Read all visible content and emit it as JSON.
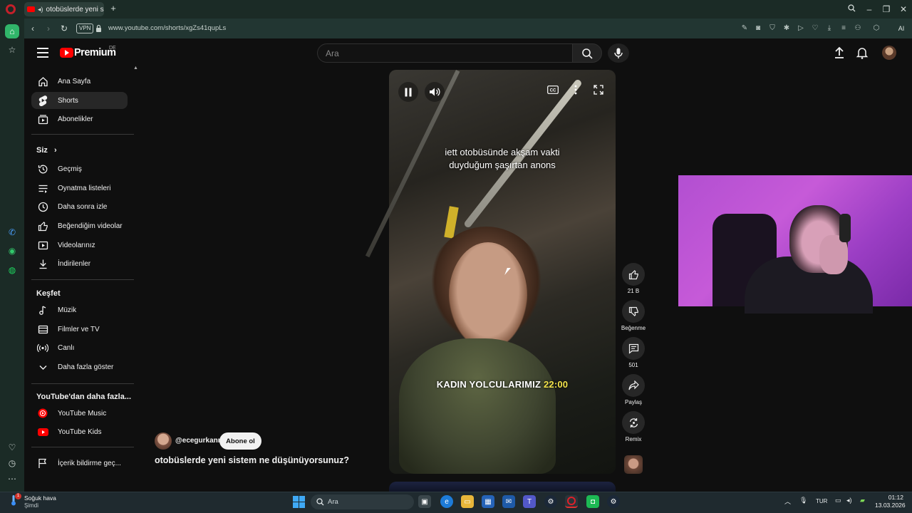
{
  "browser": {
    "tab_title": "otobüslerde yeni siste",
    "url": "www.youtube.com/shorts/xgZs41qupLs",
    "vpn_label": "VPN",
    "ai_label": "AI"
  },
  "youtube": {
    "logo_text": "Premium",
    "region": "DE",
    "search_placeholder": "Ara",
    "sidebar": {
      "main": [
        {
          "label": "Ana Sayfa",
          "icon": "home-icon"
        },
        {
          "label": "Shorts",
          "icon": "shorts-icon",
          "active": true
        },
        {
          "label": "Abonelikler",
          "icon": "subscriptions-icon"
        }
      ],
      "you_header": "Siz",
      "you": [
        {
          "label": "Geçmiş",
          "icon": "history-icon"
        },
        {
          "label": "Oynatma listeleri",
          "icon": "playlist-icon"
        },
        {
          "label": "Daha sonra izle",
          "icon": "clock-icon"
        },
        {
          "label": "Beğendiğim videolar",
          "icon": "thumbs-up-icon"
        },
        {
          "label": "Videolarınız",
          "icon": "video-icon"
        },
        {
          "label": "İndirilenler",
          "icon": "download-icon"
        }
      ],
      "explore_header": "Keşfet",
      "explore": [
        {
          "label": "Müzik",
          "icon": "music-icon"
        },
        {
          "label": "Filmler ve TV",
          "icon": "film-icon"
        },
        {
          "label": "Canlı",
          "icon": "live-icon"
        },
        {
          "label": "Daha fazla göster",
          "icon": "chevron-down-icon"
        }
      ],
      "more_header": "YouTube'dan daha fazla...",
      "more": [
        {
          "label": "YouTube Music",
          "icon": "youtube-music-icon"
        },
        {
          "label": "YouTube Kids",
          "icon": "youtube-kids-icon"
        }
      ],
      "report": {
        "label": "İçerik bildirme geç...",
        "icon": "flag-icon"
      }
    },
    "short": {
      "caption_top_line1": "iett otobüsünde akşam vakti",
      "caption_top_line2": "duyduğum şaşırtan anons",
      "caption_bottom_text": "KADIN YOLCULARIMIZ",
      "caption_bottom_time": "22:00",
      "channel": "@ecegurkann",
      "subscribe_label": "Abone ol",
      "title": "otobüslerde yeni sistem ne düşünüyorsunuz?"
    },
    "actions": {
      "like_count": "21 B",
      "dislike_label": "Beğenme",
      "comment_count": "501",
      "share_label": "Paylaş",
      "remix_label": "Remix"
    }
  },
  "taskbar": {
    "weather_title": "Soğuk hava",
    "weather_sub": "Şimdi",
    "weather_badge": "1",
    "search_placeholder": "Ara",
    "language": "TUR",
    "time": "01:12",
    "date": "13.03.2026"
  },
  "colors": {
    "youtube_red": "#ff0000",
    "caption_time": "#f2e24a",
    "webcam_bg": "#b24fd1"
  }
}
